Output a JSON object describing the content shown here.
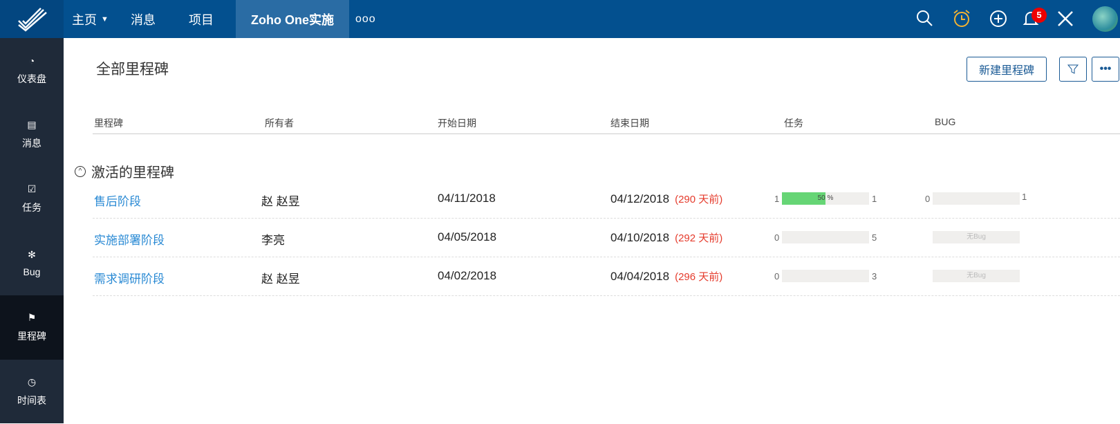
{
  "topbar": {
    "nav": [
      "主页",
      "消息",
      "项目",
      "Zoho One实施"
    ],
    "more": "ooo",
    "notification_count": "5"
  },
  "sidebar": [
    {
      "label": "仪表盘",
      "icon": "dashboard-icon"
    },
    {
      "label": "消息",
      "icon": "feed-icon"
    },
    {
      "label": "任务",
      "icon": "task-icon"
    },
    {
      "label": "Bug",
      "icon": "bug-icon"
    },
    {
      "label": "里程碑",
      "icon": "milestone-icon"
    },
    {
      "label": "时间表",
      "icon": "timer-icon"
    }
  ],
  "page": {
    "title": "全部里程碑",
    "new_button": "新建里程碑"
  },
  "columns": [
    "里程碑",
    "所有者",
    "开始日期",
    "结束日期",
    "任务",
    "BUG"
  ],
  "group": "激活的里程碑",
  "rows": [
    {
      "name": "售后阶段",
      "owner": "赵 赵昱",
      "start": "04/11/2018",
      "end": "04/12/2018",
      "late": "(290 天前)",
      "task_done": "1",
      "task_total": "1",
      "task_pct": 50,
      "task_label": "50 %",
      "bug_done": "0",
      "bug_total": "1",
      "bug_label": ""
    },
    {
      "name": "实施部署阶段",
      "owner": "李亮",
      "start": "04/05/2018",
      "end": "04/10/2018",
      "late": "(292 天前)",
      "task_done": "0",
      "task_total": "5",
      "task_pct": 0,
      "task_label": "",
      "bug_done": "",
      "bug_total": "",
      "bug_label": "无Bug"
    },
    {
      "name": "需求调研阶段",
      "owner": "赵 赵昱",
      "start": "04/02/2018",
      "end": "04/04/2018",
      "late": "(296 天前)",
      "task_done": "0",
      "task_total": "3",
      "task_pct": 0,
      "task_label": "",
      "bug_done": "",
      "bug_total": "",
      "bug_label": "无Bug"
    }
  ]
}
